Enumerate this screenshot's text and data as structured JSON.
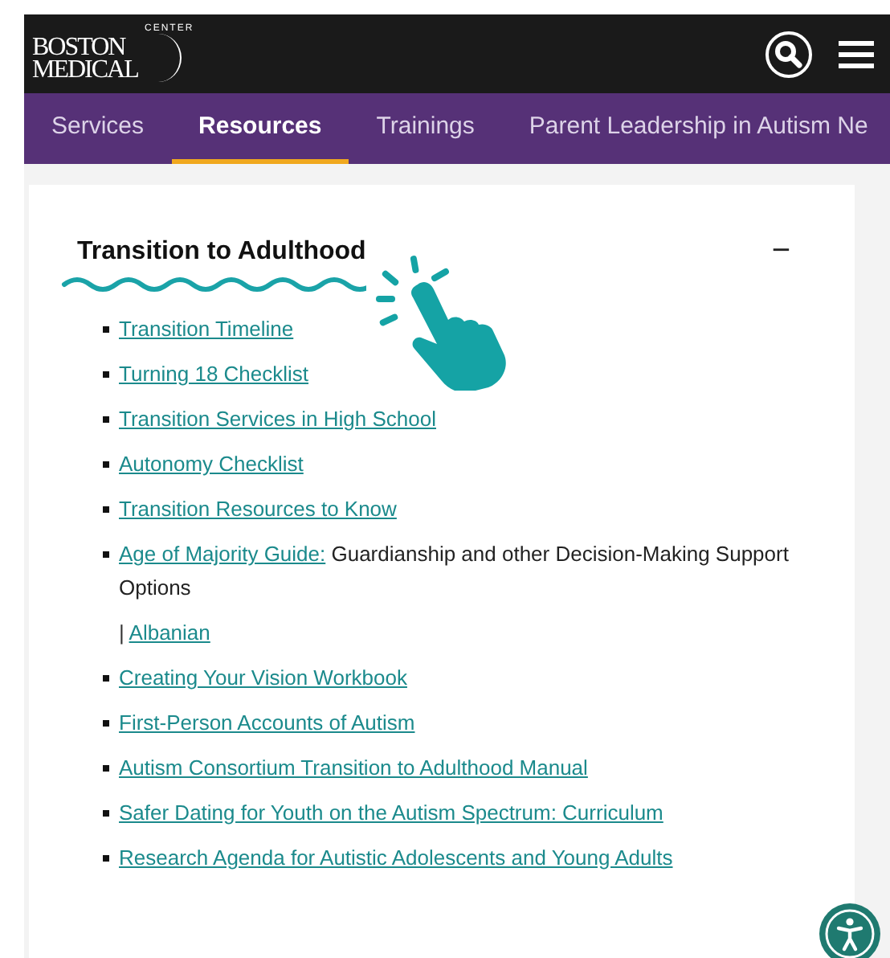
{
  "logo": {
    "line_1": "BOSTON",
    "line_2": "MEDICAL",
    "arc": "CENTER"
  },
  "nav": {
    "tabs": [
      {
        "label": "Services",
        "selected": false
      },
      {
        "label": "Resources",
        "selected": true
      },
      {
        "label": "Trainings",
        "selected": false
      },
      {
        "label": "Parent Leadership in Autism Ne",
        "selected": false
      }
    ]
  },
  "section": {
    "title": "Transition to Adulthood",
    "toggle": "−",
    "items": [
      {
        "link": "Transition Timeline"
      },
      {
        "link": "Turning 18 Checklist"
      },
      {
        "link": "Transition Services in High School"
      },
      {
        "link": "Autonomy Checklist"
      },
      {
        "link": "Transition Resources to Know"
      },
      {
        "link": "Age of Majority Guide:",
        "text": "Guardianship and other Decision-Making Support Options",
        "separator": "|",
        "sublinks": [
          "Albanian"
        ]
      },
      {
        "link": "Creating Your Vision Workbook"
      },
      {
        "link": "First-Person Accounts of Autism"
      },
      {
        "link": "Autism Consortium Transition to Adulthood Manual"
      },
      {
        "link": "Safer Dating for Youth on the Autism Spectrum: Curriculum"
      },
      {
        "link": "Research Agenda for Autistic Adolescents and Young Adults"
      }
    ]
  }
}
